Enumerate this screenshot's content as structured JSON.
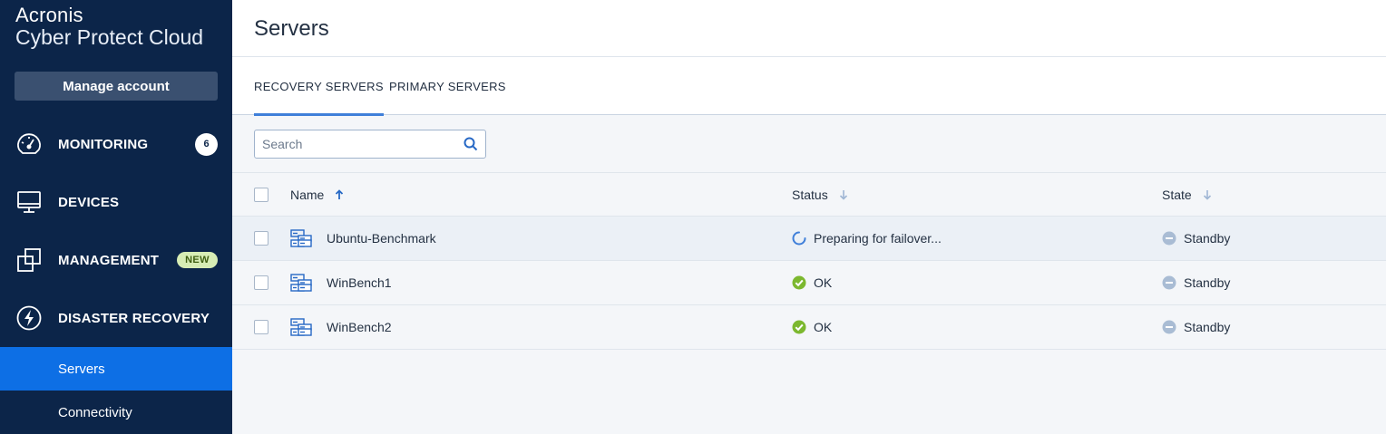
{
  "sidebar": {
    "brand": "Acronis",
    "product": "Cyber Protect Cloud",
    "manage_account": "Manage account",
    "items": [
      {
        "label": "MONITORING",
        "icon": "speedometer-icon",
        "badge": "6"
      },
      {
        "label": "DEVICES",
        "icon": "monitor-icon"
      },
      {
        "label": "MANAGEMENT",
        "icon": "stacked-squares-icon",
        "badge": "NEW"
      },
      {
        "label": "DISASTER RECOVERY",
        "icon": "lightning-icon"
      }
    ],
    "subitems": [
      {
        "label": "Servers",
        "active": true
      },
      {
        "label": "Connectivity",
        "active": false
      }
    ]
  },
  "header": {
    "title": "Servers"
  },
  "tabs": [
    {
      "label": "RECOVERY SERVERS",
      "active": true
    },
    {
      "label": "PRIMARY SERVERS",
      "active": false
    }
  ],
  "search": {
    "placeholder": "Search"
  },
  "table": {
    "columns": [
      {
        "label": "Name",
        "sort": "ascending"
      },
      {
        "label": "Status",
        "sort": "none"
      },
      {
        "label": "State",
        "sort": "none"
      }
    ],
    "rows": [
      {
        "name": "Ubuntu-Benchmark",
        "status": "Preparing for failover...",
        "status_icon": "spinner-icon",
        "state": "Standby"
      },
      {
        "name": "WinBench1",
        "status": "OK",
        "status_icon": "ok-check-icon",
        "state": "Standby"
      },
      {
        "name": "WinBench2",
        "status": "OK",
        "status_icon": "ok-check-icon",
        "state": "Standby"
      }
    ]
  },
  "colors": {
    "sidebar_bg": "#0c2549",
    "active_nav": "#0d6fe5",
    "accent": "#3f7fd9",
    "ok": "#7cb82f",
    "standby": "#a9bcd4"
  }
}
